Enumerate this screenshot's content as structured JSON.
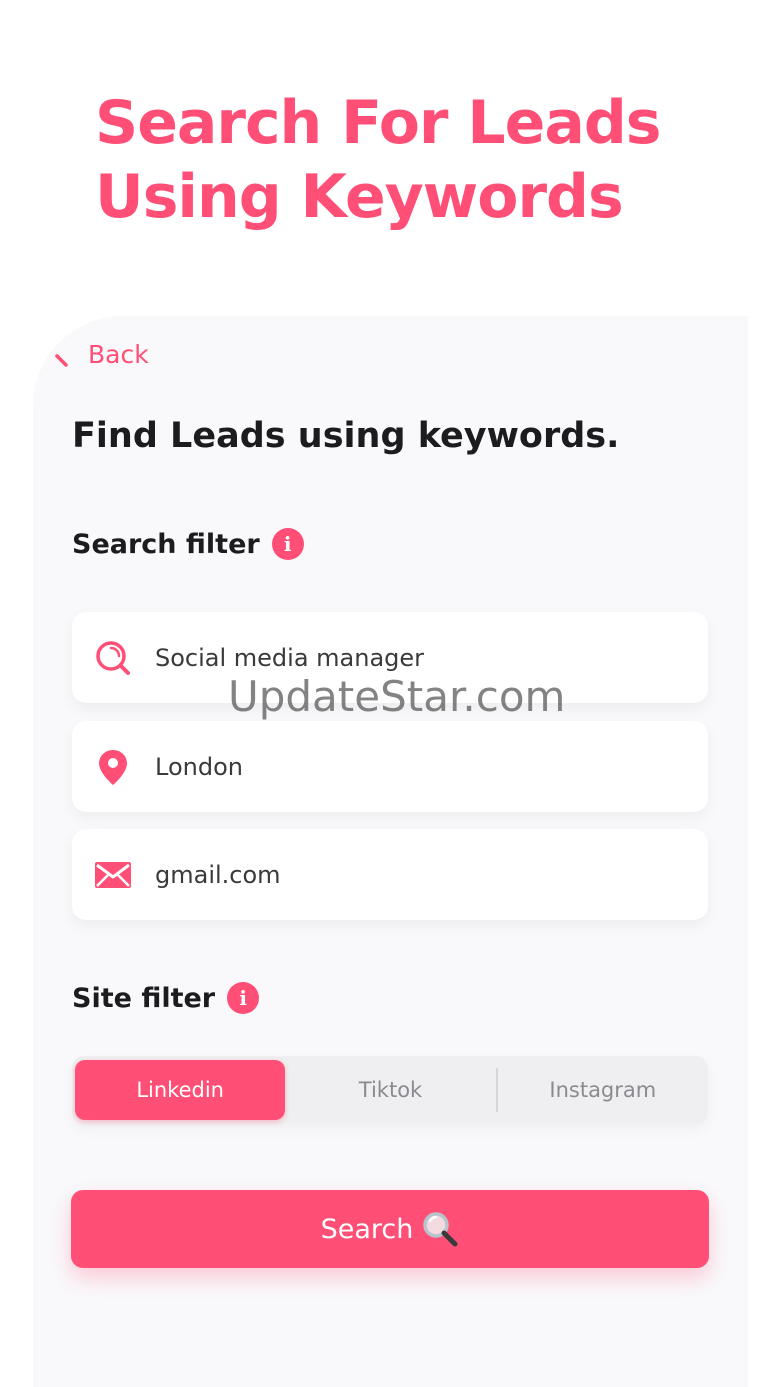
{
  "hero": {
    "line1": "Search For Leads",
    "line2": "Using Keywords"
  },
  "nav": {
    "back_label": "Back"
  },
  "form": {
    "title": "Find Leads using keywords.",
    "search_filter_label": "Search filter",
    "keyword_value": "Social media manager",
    "location_value": "London",
    "email_domain_value": "gmail.com",
    "site_filter_label": "Site filter",
    "sites": [
      "Linkedin",
      "Tiktok",
      "Instagram"
    ],
    "selected_site": "Linkedin",
    "search_button_label": "Search"
  },
  "watermark": "UpdateStar.com",
  "colors": {
    "accent": "#ff4f76",
    "panel_bg": "#f9f9fb",
    "segment_bg": "#efeff1"
  },
  "icons": {
    "keyword": "search-icon",
    "location": "location-pin-icon",
    "email": "mail-icon",
    "info": "info-icon",
    "button": "magnifier-icon"
  }
}
